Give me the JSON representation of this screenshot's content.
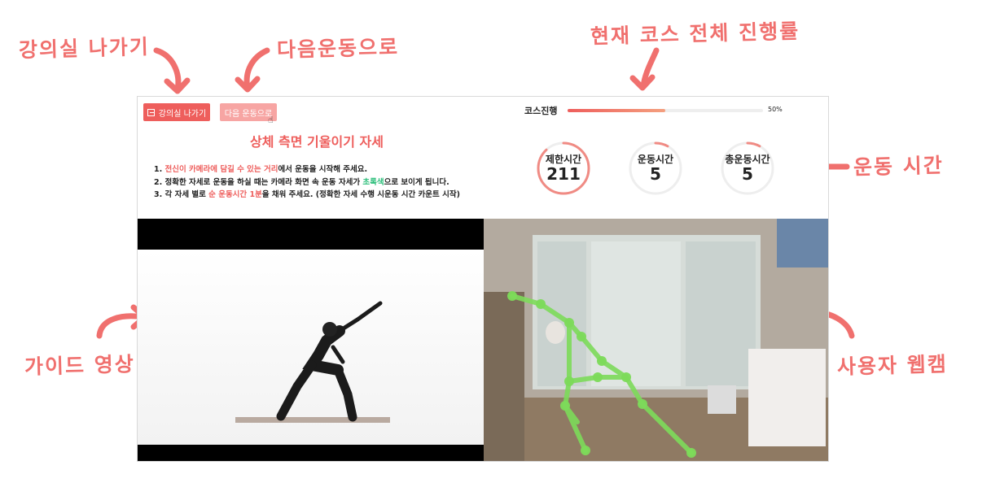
{
  "annotations": {
    "exit": "강의실 나가기",
    "next": "다음운동으로",
    "progress": "현재 코스 전체 진행률",
    "time": "운동 시간",
    "guide": "가이드 영상",
    "webcam": "사용자 웹캠"
  },
  "header": {
    "exit_label": "강의실 나가기",
    "next_label": "다음 운동으로"
  },
  "progress": {
    "label": "코스진행",
    "value": 0.5,
    "percent_text": "50%"
  },
  "pose_title": "상체 측면 기울이기 자세",
  "instructions": {
    "l1_prefix": "1. ",
    "l1_hl": "전신이 카메라에 담길 수 있는 거리",
    "l1_suffix": "에서 운동을 시작해 주세요.",
    "l2_prefix": "2. 정확한 자세로 운동을 하실 때는 카메라 화면 속 운동 자세가 ",
    "l2_hl": "초록색",
    "l2_suffix": "으로 보이게 됩니다.",
    "l3_prefix": "3. 각 자세 별로 ",
    "l3_hl": "순 운동시간 1분",
    "l3_suffix": "을 채워 주세요. (정확한 자세 수행 시운동 시간 카운트 시작)"
  },
  "timers": [
    {
      "label": "제한시간",
      "value": "211",
      "progress": 0.88
    },
    {
      "label": "운동시간",
      "value": "5",
      "progress": 0.08
    },
    {
      "label": "총운동시간",
      "value": "5",
      "progress": 0.08
    }
  ],
  "colors": {
    "accent": "#ee5e5c",
    "accent_light": "#f7a5a3",
    "highlight_green": "#2fbf7c",
    "skeleton": "#7ddb5a",
    "annotation": "#f0706e"
  },
  "icons": {
    "exit": "exit-door-icon",
    "cursor": "hand-pointer-icon"
  }
}
